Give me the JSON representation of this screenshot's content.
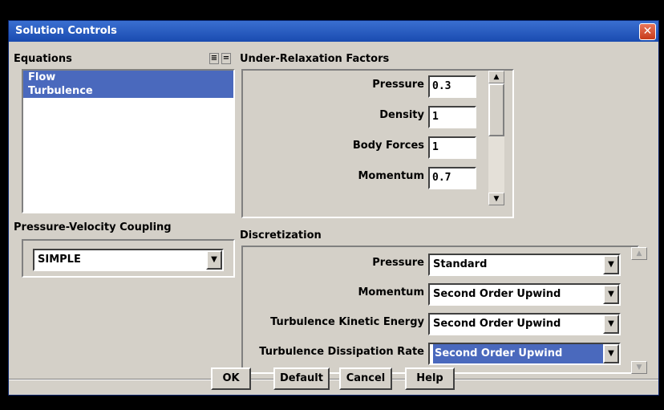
{
  "window": {
    "title": "Solution Controls"
  },
  "equations": {
    "label": "Equations",
    "items": [
      "Flow",
      "Turbulence"
    ]
  },
  "coupling": {
    "label": "Pressure-Velocity Coupling",
    "value": "SIMPLE"
  },
  "urf": {
    "label": "Under-Relaxation Factors",
    "rows": [
      {
        "label": "Pressure",
        "value": "0.3"
      },
      {
        "label": "Density",
        "value": "1"
      },
      {
        "label": "Body Forces",
        "value": "1"
      },
      {
        "label": "Momentum",
        "value": "0.7"
      }
    ]
  },
  "discretization": {
    "label": "Discretization",
    "rows": [
      {
        "label": "Pressure",
        "value": "Standard"
      },
      {
        "label": "Momentum",
        "value": "Second Order Upwind"
      },
      {
        "label": "Turbulence Kinetic Energy",
        "value": "Second Order Upwind"
      },
      {
        "label": "Turbulence Dissipation Rate",
        "value": "Second Order Upwind"
      }
    ]
  },
  "buttons": {
    "ok": "OK",
    "default": "Default",
    "cancel": "Cancel",
    "help": "Help"
  },
  "colors": {
    "titlebar": "#2a5cc4",
    "selection": "#4a69bd",
    "close": "#d9512b"
  }
}
